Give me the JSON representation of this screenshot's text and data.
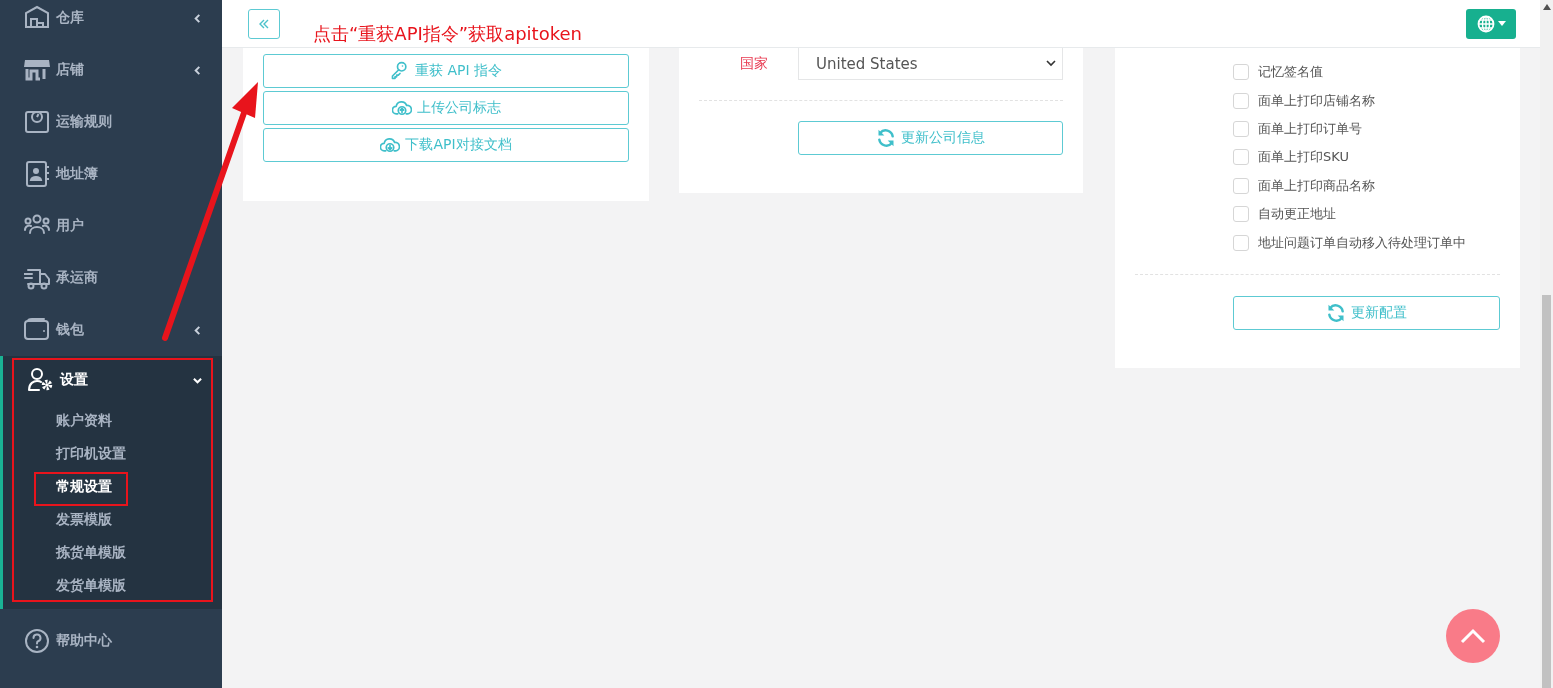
{
  "sidebar": {
    "items": [
      {
        "label": "仓库",
        "kind": "group",
        "expanded": false
      },
      {
        "label": "店铺",
        "kind": "group",
        "expanded": false
      },
      {
        "label": "运输规则",
        "kind": "link"
      },
      {
        "label": "地址簿",
        "kind": "link"
      },
      {
        "label": "用户",
        "kind": "link"
      },
      {
        "label": "承运商",
        "kind": "link"
      },
      {
        "label": "钱包",
        "kind": "group",
        "expanded": false
      },
      {
        "label": "设置",
        "kind": "group",
        "expanded": true,
        "children": [
          {
            "label": "账户资料",
            "selected": false
          },
          {
            "label": "打印机设置",
            "selected": false
          },
          {
            "label": "常规设置",
            "selected": true
          },
          {
            "label": "发票模版",
            "selected": false
          },
          {
            "label": "拣货单模版",
            "selected": false
          },
          {
            "label": "发货单模版",
            "selected": false
          }
        ]
      },
      {
        "label": "帮助中心",
        "kind": "link"
      }
    ]
  },
  "annotation": {
    "text": "点击“重获API指令”获取apitoken"
  },
  "api_card": {
    "buttons": [
      {
        "label": "重获 API 指令"
      },
      {
        "label": "上传公司标志"
      },
      {
        "label": "下载API对接文档"
      }
    ]
  },
  "company_card": {
    "field_label": "国家",
    "value": "United States",
    "button": "更新公司信息"
  },
  "config_card": {
    "options": [
      {
        "label": "记忆签名值",
        "checked": false
      },
      {
        "label": "面单上打印店铺名称",
        "checked": false
      },
      {
        "label": "面单上打印订单号",
        "checked": false
      },
      {
        "label": "面单上打印SKU",
        "checked": false
      },
      {
        "label": "面单上打印商品名称",
        "checked": false
      },
      {
        "label": "自动更正地址",
        "checked": false
      },
      {
        "label": "地址问题订单自动移入待处理订单中",
        "checked": false
      }
    ],
    "button": "更新配置"
  }
}
